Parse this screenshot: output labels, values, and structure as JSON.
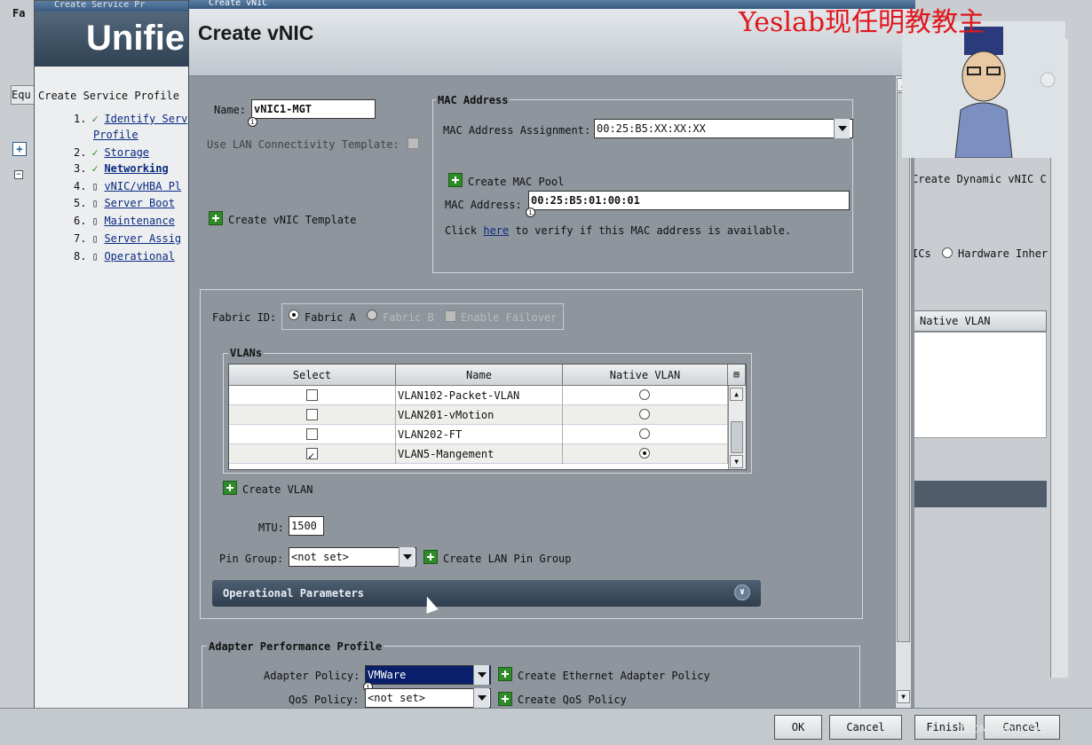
{
  "background": {
    "outer_window": {
      "title_fragment": "Fa",
      "tab": "Equ"
    },
    "wizard": {
      "title": "Create Service Pr",
      "banner_text": "Unifie",
      "heading": "Create Service Profile",
      "steps": [
        {
          "num": "1.",
          "label": "Identify Serv",
          "label2": "Profile",
          "checked": true,
          "bold": false
        },
        {
          "num": "2.",
          "label": "Storage",
          "checked": true,
          "bold": false
        },
        {
          "num": "3.",
          "label": "Networking",
          "checked": true,
          "bold": true
        },
        {
          "num": "4.",
          "label": "vNIC/vHBA Pl",
          "checked": false
        },
        {
          "num": "5.",
          "label": "Server Boot",
          "checked": false
        },
        {
          "num": "6.",
          "label": "Maintenance",
          "checked": false
        },
        {
          "num": "7.",
          "label": "Server Assig",
          "checked": false
        },
        {
          "num": "8.",
          "label": "Operational",
          "checked": false
        }
      ]
    },
    "right_window": {
      "create_dynamic": "Create Dynamic vNIC C",
      "ics_text": "ICs",
      "hardware_inher": "Hardware Inher",
      "native_vlan_col": "Native VLAN",
      "finish_label": "Finish",
      "cancel_label": "Cancel"
    }
  },
  "dialog": {
    "titlebar": "Create vNIC",
    "header_title": "Create vNIC",
    "name_label": "Name:",
    "name_value": "vNIC1-MGT",
    "lan_template_label": "Use LAN Connectivity Template:",
    "create_vnic_template": "Create vNIC Template",
    "mac": {
      "legend": "MAC Address",
      "assignment_label": "MAC Address Assignment:",
      "assignment_value": "00:25:B5:XX:XX:XX",
      "create_pool": "Create MAC Pool",
      "address_label": "MAC Address:",
      "address_value": "00:25:B5:01:00:01",
      "verify_prefix": "Click",
      "verify_link": "here",
      "verify_suffix": "to verify if this MAC address is available."
    },
    "fabric": {
      "label": "Fabric ID:",
      "a": "Fabric A",
      "b": "Fabric B",
      "failover": "Enable Failover",
      "selected": "Fabric A"
    },
    "vlans": {
      "legend": "VLANs",
      "columns": [
        "Select",
        "Name",
        "Native VLAN"
      ],
      "rows": [
        {
          "select": false,
          "name": "VLAN102-Packet-VLAN",
          "native": false
        },
        {
          "select": false,
          "name": "VLAN201-vMotion",
          "native": false
        },
        {
          "select": false,
          "name": "VLAN202-FT",
          "native": false
        },
        {
          "select": true,
          "name": "VLAN5-Mangement",
          "native": true
        }
      ]
    },
    "create_vlan": "Create VLAN",
    "mtu_label": "MTU:",
    "mtu_value": "1500",
    "pin_group_label": "Pin Group:",
    "pin_group_value": "<not set>",
    "create_lan_pin_group": "Create LAN Pin Group",
    "operational_parameters": "Operational Parameters",
    "adapter": {
      "legend": "Adapter Performance Profile",
      "policy_label": "Adapter Policy:",
      "policy_value": "VMWare",
      "create_eth_policy": "Create Ethernet Adapter Policy",
      "qos_label": "QoS Policy:",
      "qos_value": "<not set>",
      "create_qos": "Create QoS Policy"
    },
    "ok_label": "OK",
    "cancel_label": "Cancel"
  },
  "overlay": {
    "watermark": "Yeslab现任明教教主",
    "corner_text": "CSDN @Sme_Sec"
  },
  "colors": {
    "accent": "#2f8a2a",
    "dark_bar": "#2f3e4e",
    "watermark": "#e0171d"
  }
}
